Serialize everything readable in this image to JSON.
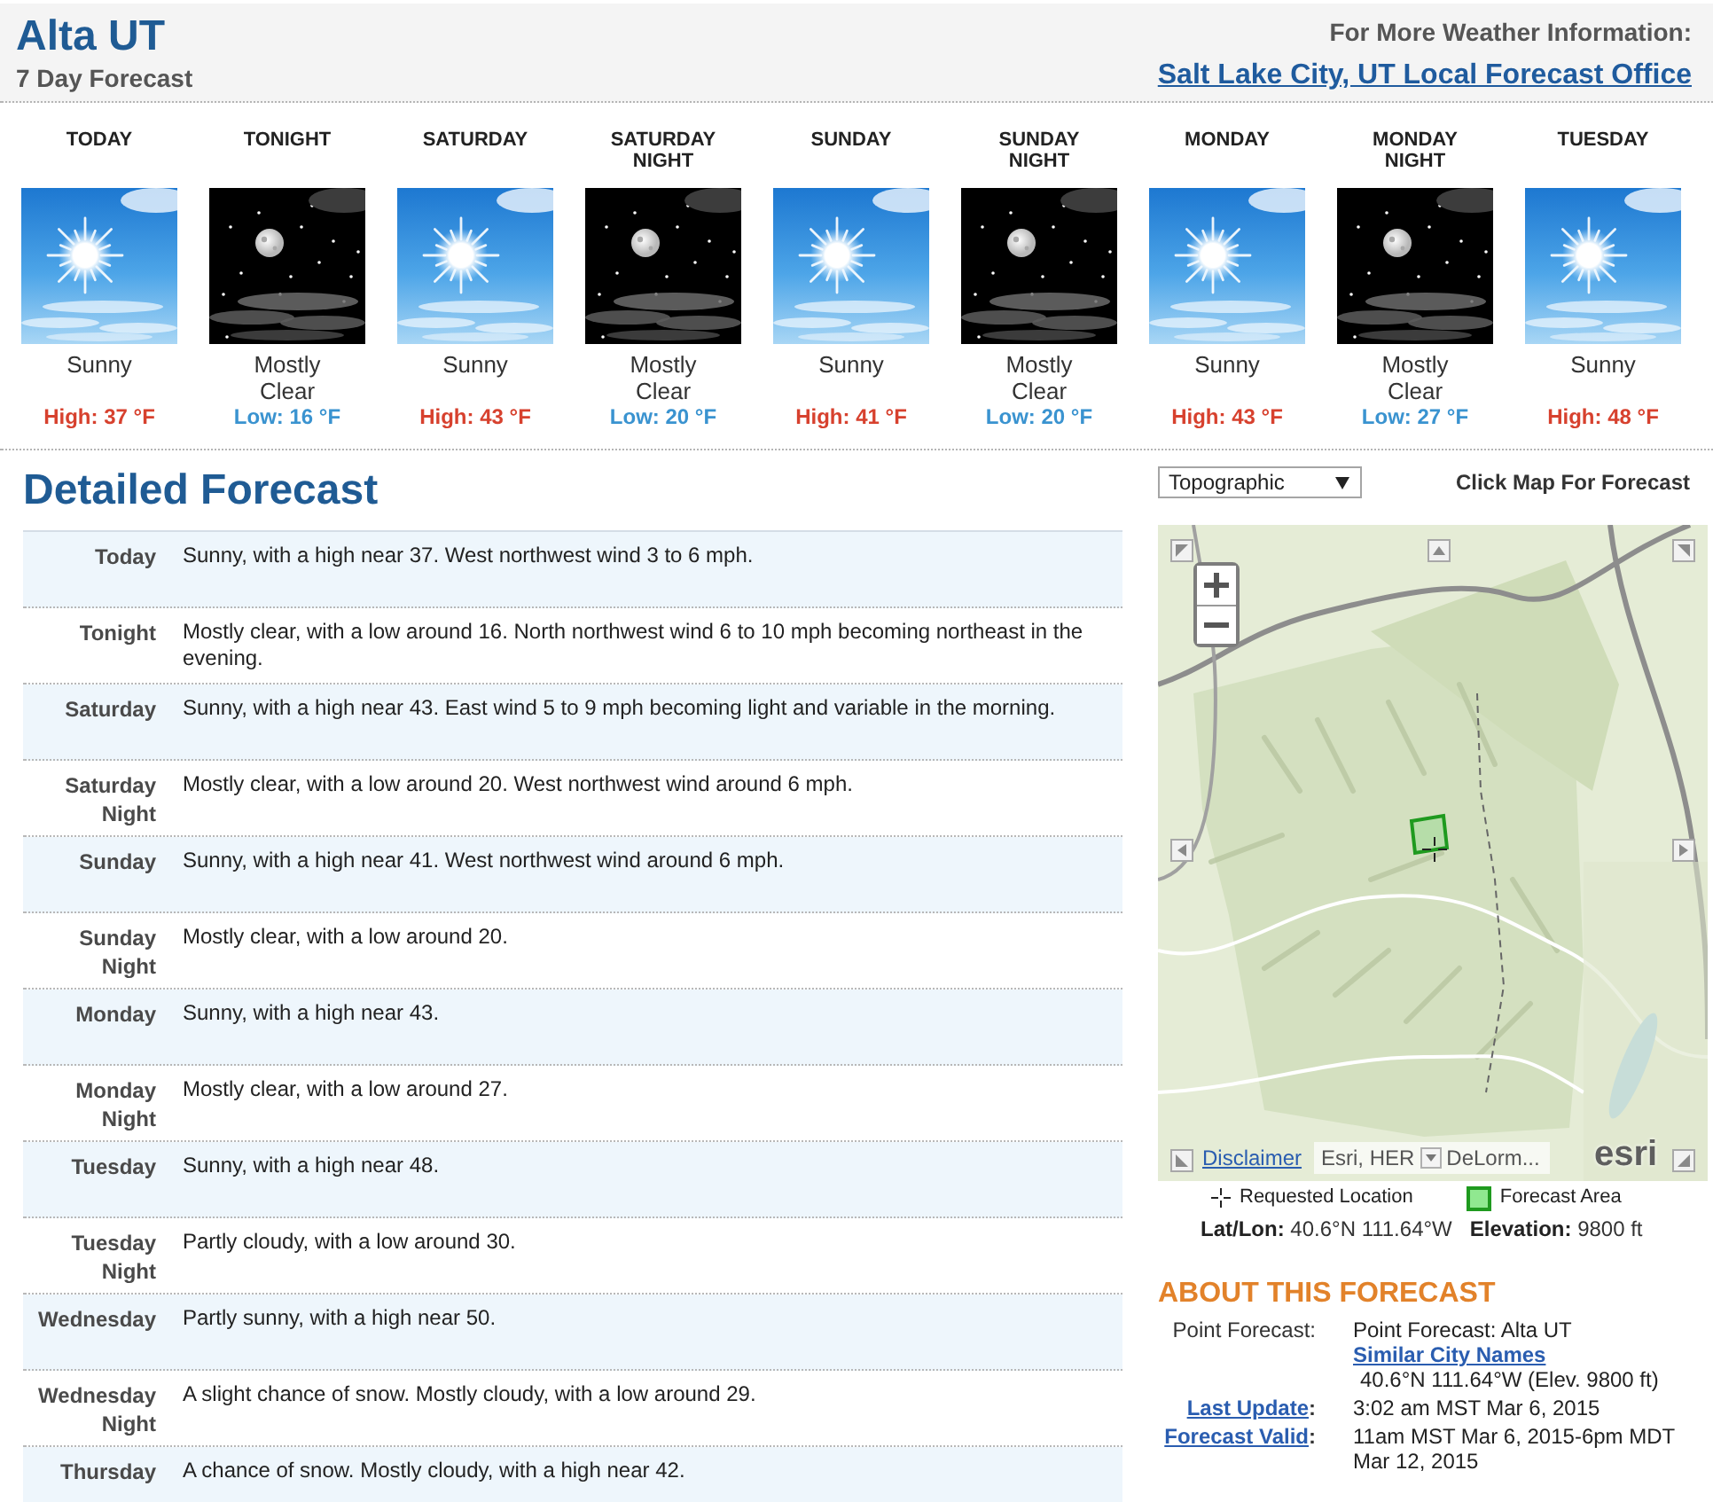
{
  "header": {
    "title": "Alta UT",
    "subtitle": "7 Day Forecast",
    "info_label": "For More Weather Information:",
    "office_link": "Salt Lake City, UT Local Forecast Office"
  },
  "periods": [
    {
      "name": "TODAY",
      "kind": "day",
      "summary": "Sunny",
      "temp": "High: 37 °F"
    },
    {
      "name": "TONIGHT",
      "kind": "night",
      "summary": "Mostly Clear",
      "temp": "Low: 16 °F"
    },
    {
      "name": "SATURDAY",
      "kind": "day",
      "summary": "Sunny",
      "temp": "High: 43 °F"
    },
    {
      "name": "SATURDAY NIGHT",
      "kind": "night",
      "summary": "Mostly Clear",
      "temp": "Low: 20 °F"
    },
    {
      "name": "SUNDAY",
      "kind": "day",
      "summary": "Sunny",
      "temp": "High: 41 °F"
    },
    {
      "name": "SUNDAY NIGHT",
      "kind": "night",
      "summary": "Mostly Clear",
      "temp": "Low: 20 °F"
    },
    {
      "name": "MONDAY",
      "kind": "day",
      "summary": "Sunny",
      "temp": "High: 43 °F"
    },
    {
      "name": "MONDAY NIGHT",
      "kind": "night",
      "summary": "Mostly Clear",
      "temp": "Low: 27 °F"
    },
    {
      "name": "TUESDAY",
      "kind": "day",
      "summary": "Sunny",
      "temp": "High: 48 °F"
    }
  ],
  "detailed": {
    "title": "Detailed Forecast",
    "rows": [
      {
        "period": "Today",
        "text": "Sunny, with a high near 37. West northwest wind 3 to 6 mph."
      },
      {
        "period": "Tonight",
        "text": "Mostly clear, with a low around 16. North northwest wind 6 to 10 mph becoming northeast in the evening."
      },
      {
        "period": "Saturday",
        "text": "Sunny, with a high near 43. East wind 5 to 9 mph becoming light and variable in the morning."
      },
      {
        "period": "Saturday Night",
        "text": "Mostly clear, with a low around 20. West northwest wind around 6 mph."
      },
      {
        "period": "Sunday",
        "text": "Sunny, with a high near 41. West northwest wind around 6 mph."
      },
      {
        "period": "Sunday Night",
        "text": "Mostly clear, with a low around 20."
      },
      {
        "period": "Monday",
        "text": "Sunny, with a high near 43."
      },
      {
        "period": "Monday Night",
        "text": "Mostly clear, with a low around 27."
      },
      {
        "period": "Tuesday",
        "text": "Sunny, with a high near 48."
      },
      {
        "period": "Tuesday Night",
        "text": "Partly cloudy, with a low around 30."
      },
      {
        "period": "Wednesday",
        "text": "Partly sunny, with a high near 50."
      },
      {
        "period": "Wednesday Night",
        "text": "A slight chance of snow. Mostly cloudy, with a low around 29."
      },
      {
        "period": "Thursday",
        "text": "A chance of snow. Mostly cloudy, with a high near 42."
      }
    ]
  },
  "map_panel": {
    "layer_select": {
      "value": "Topographic"
    },
    "hint": "Click Map For Forecast",
    "map": {
      "disclaimer": "Disclaimer",
      "attribution": [
        "Esri, HER",
        "DeLorm..."
      ],
      "logo": "esri"
    },
    "legend": [
      {
        "kind": "crosshair",
        "label": "Requested Location"
      },
      {
        "kind": "area",
        "label": "Forecast Area"
      }
    ],
    "location": [
      "**Lat/Lon:** 40.6°N 111.64°W",
      "**Elevation:** 9800 ft"
    ]
  },
  "about": {
    "title": "ABOUT THIS FORECAST",
    "rows": [
      {
        "kind": "plain",
        "label": "Point Forecast:",
        "value": "Point Forecast: Alta UT",
        "link": "Similar City Names",
        "detail": "40.6°N 111.64°W (Elev. 9800 ft)"
      },
      {
        "kind": "link",
        "label": "Last Update",
        "suffix": ":",
        "value": "3:02 am MST Mar 6, 2015"
      },
      {
        "kind": "link",
        "label": "Forecast Valid",
        "suffix": ":",
        "value": "11am MST Mar 6, 2015-6pm MDT Mar 12, 2015"
      }
    ]
  }
}
